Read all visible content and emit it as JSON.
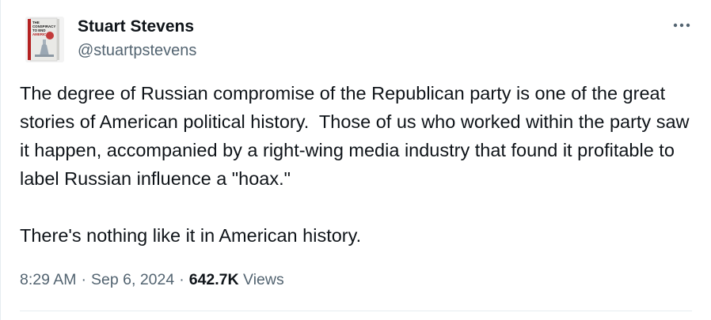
{
  "author": {
    "display_name": "Stuart Stevens",
    "handle": "@stuartpstevens",
    "avatar_book_title": [
      "THE",
      "CONSPIRACY",
      "TO END",
      "AMERICA"
    ]
  },
  "tweet": {
    "text_paragraph_1": "The degree of Russian compromise of the Republican party is one of the great stories of American political history.  Those of us who worked within the party saw it happen, accompanied by a right-wing media industry that found it profitable to label Russian influence a \"hoax.\"",
    "text_paragraph_2": "There's nothing like it in American history."
  },
  "meta": {
    "time": "8:29 AM",
    "separator": "·",
    "date": "Sep 6, 2024",
    "views_count": "642.7K",
    "views_label": "Views"
  },
  "icons": {
    "more": "more-horizontal-icon"
  },
  "colors": {
    "text_primary": "#0f1419",
    "text_secondary": "#536471",
    "divider": "#e6ecf0"
  }
}
